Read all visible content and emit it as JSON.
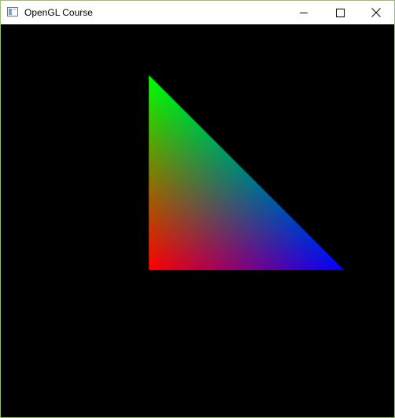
{
  "window": {
    "title": "OpenGL Course",
    "title_bar_color": "#ffffff",
    "border_color": "#9bbf6a"
  },
  "controls": {
    "minimize_icon": "minimize-icon",
    "maximize_icon": "maximize-icon",
    "close_icon": "close-icon"
  },
  "scene": {
    "clear_color": "#000000",
    "triangle": {
      "vertex_colors": {
        "top": "#00ff00",
        "bottom_left": "#ff0000",
        "bottom_right": "#0000ff"
      }
    }
  }
}
